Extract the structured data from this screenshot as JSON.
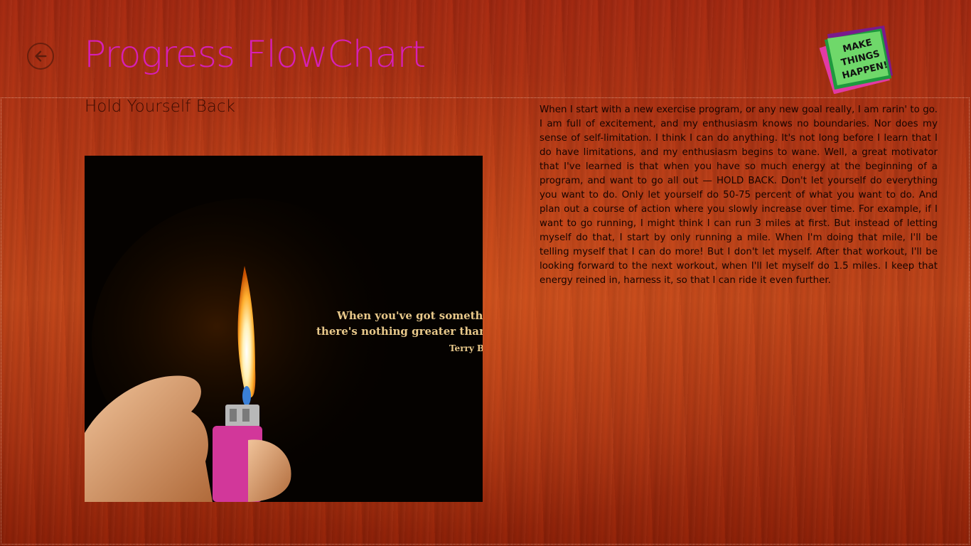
{
  "header": {
    "title": "Progress FlowChart",
    "back_icon": "back-arrow-icon"
  },
  "logo": {
    "text_line1": "MAKE",
    "text_line2": "THINGS",
    "text_line3": "HAPPEN!"
  },
  "article": {
    "heading": "Hold Yourself Back",
    "image": {
      "quote_line1": "When you've got something to",
      "quote_line2": "there's nothing greater than a chal",
      "quote_author": "Terry Br"
    },
    "body": "When I start with a new exercise program, or any new goal really, I am rarin' to go. I am full of excitement, and my enthusiasm knows no boundaries. Nor does my sense of self-limitation. I think I can do anything. It's not long before I learn that I do have limitations, and my enthusiasm begins to wane. Well, a great motivator that I've learned is that when you have so much energy at the beginning of a program, and want to go all out — HOLD BACK. Don't let yourself do everything you want to do. Only let yourself do 50-75 percent of what you want to do. And plan out a course of action where you slowly increase over time. For example, if I want to go running, I might think I can run 3 miles at first. But instead of letting myself do that, I start by only running a mile. When I'm doing that mile, I'll be telling myself that I can do more! But I don't let myself. After that workout, I'll be looking forward to the next workout, when I'll let myself do 1.5 miles. I keep that energy reined in, harness it, so that I can ride it even further."
  },
  "colors": {
    "title": "#d61fb8",
    "background": "#b53a16",
    "text": "#170400"
  }
}
